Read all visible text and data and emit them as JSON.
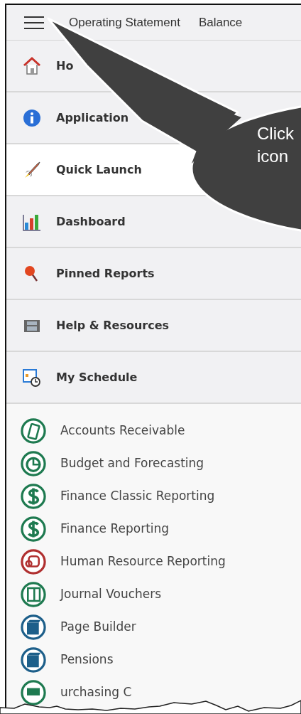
{
  "top_tabs": [
    {
      "label": "Operating Statement"
    },
    {
      "label": "Balance"
    }
  ],
  "nav_menu": [
    {
      "label": "Ho",
      "kind": "home",
      "selected": false
    },
    {
      "label": "Application",
      "kind": "info",
      "selected": false
    },
    {
      "label": "Quick Launch",
      "kind": "rocket",
      "selected": true
    },
    {
      "label": "Dashboard",
      "kind": "chart",
      "selected": false
    },
    {
      "label": "Pinned Reports",
      "kind": "pin",
      "selected": false
    },
    {
      "label": "Help & Resources",
      "kind": "film",
      "selected": false
    },
    {
      "label": "My Schedule",
      "kind": "calendar",
      "selected": false
    }
  ],
  "apps": [
    {
      "label": "Accounts Receivable",
      "kind": "calculator",
      "color": "#1e7a50"
    },
    {
      "label": "Budget and Forecasting",
      "kind": "pie",
      "color": "#1e7a50"
    },
    {
      "label": "Finance Classic Reporting",
      "kind": "dollar",
      "color": "#1e7a50"
    },
    {
      "label": "Finance Reporting",
      "kind": "dollar",
      "color": "#1e7a50"
    },
    {
      "label": "Human Resource Reporting",
      "kind": "people",
      "color": "#b03030"
    },
    {
      "label": "Journal Vouchers",
      "kind": "book",
      "color": "#1e7a50"
    },
    {
      "label": "Page Builder",
      "kind": "cube",
      "color": "#1d5f8a"
    },
    {
      "label": "Pensions",
      "kind": "cube",
      "color": "#1d5f8a"
    },
    {
      "label": "urchasing C",
      "kind": "card",
      "color": "#1e7a50"
    }
  ],
  "callout": {
    "lines": [
      "Click",
      "icon"
    ]
  }
}
